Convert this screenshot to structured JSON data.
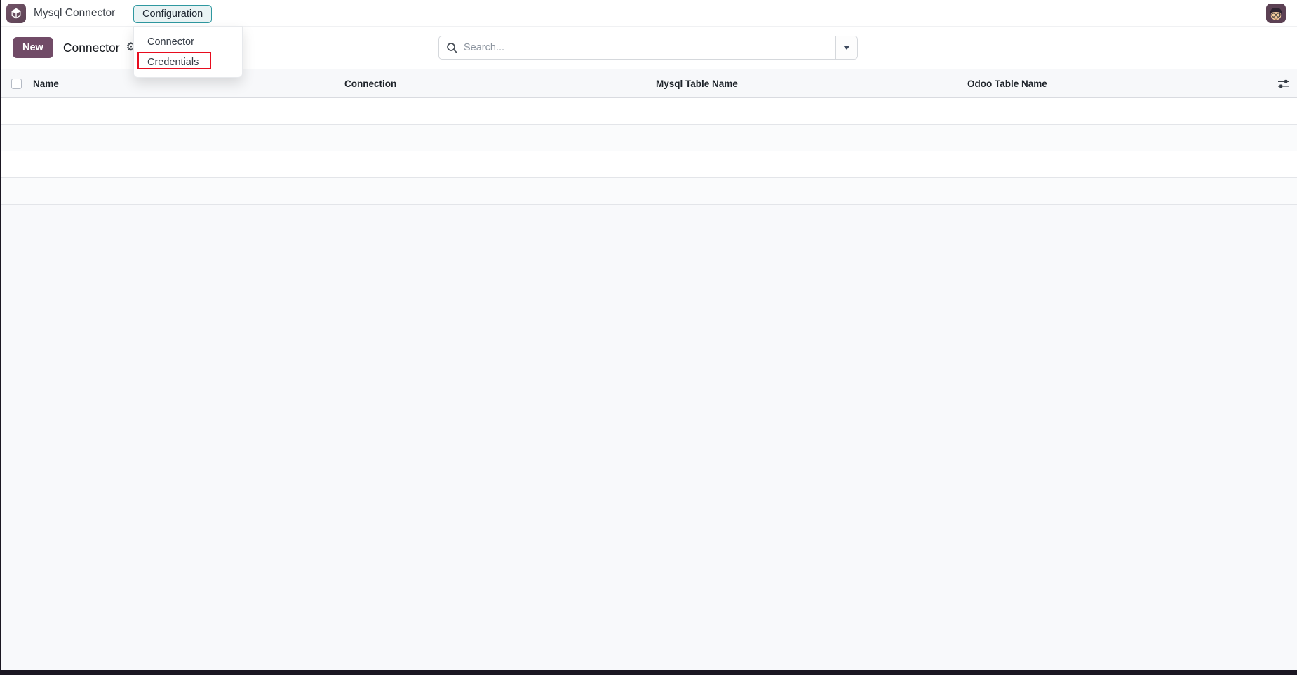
{
  "colors": {
    "brand_purple": "#714B67",
    "teal_accent": "#2f98a0",
    "annotation_red": "#e70c1e",
    "window_edge": "#1b1722"
  },
  "navbar": {
    "app_name": "Mysql Connector",
    "configuration_menu": "Configuration"
  },
  "dropdown_menu": {
    "items": [
      "Connector",
      "Credentials"
    ],
    "highlighted_item": "Credentials"
  },
  "control_panel": {
    "new_button": "New",
    "breadcrumb_title": "Connector",
    "search": {
      "placeholder": "Search..."
    }
  },
  "list_view": {
    "columns": [
      "Name",
      "Connection",
      "Mysql Table Name",
      "Odoo Table Name"
    ],
    "rows": [],
    "empty_row_count": 4
  }
}
